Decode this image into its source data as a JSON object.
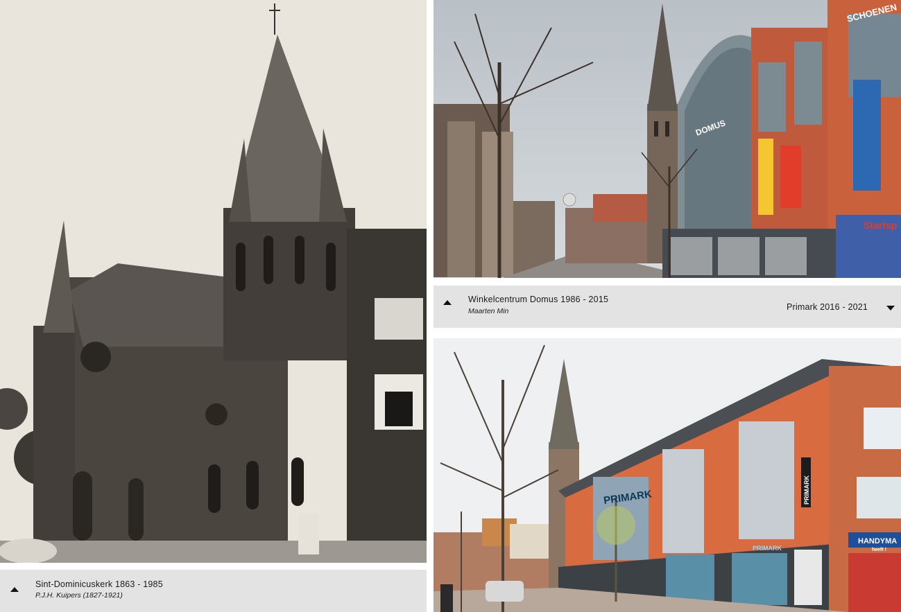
{
  "left_panel": {
    "caption": {
      "title": "Sint-Dominicuskerk 1863 - 1985",
      "subtitle": "P.J.H. Kuipers (1827-1921)"
    }
  },
  "right_top_panel": {
    "caption": {
      "title": "Winkelcentrum Domus 1986 - 2015",
      "subtitle": "Maarten Min",
      "next_label": "Primark 2016 - 2021"
    },
    "signs": {
      "top_sign": "SCHOENEN",
      "domus_sign": "DOMUS",
      "start_sign": "Startsp"
    }
  },
  "right_bottom_panel": {
    "signs": {
      "primark_main": "PRIMARK",
      "primark_vertical": "PRIMARK",
      "primark_small": "PRIMARK",
      "handyman": "HANDYMA",
      "handyman_sub": "heeft !"
    }
  },
  "colors": {
    "caption_bg": "#e3e3e3",
    "sepia_bg": "#e9e5dd",
    "brick_orange": "#d2693f"
  }
}
